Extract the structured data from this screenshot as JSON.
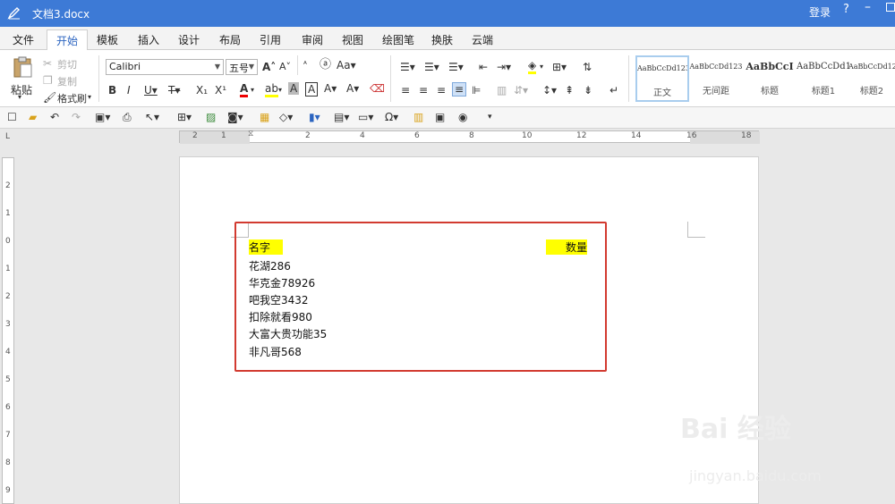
{
  "window": {
    "title": "文档3.docx",
    "login": "登录",
    "help": "?",
    "minimize": "–"
  },
  "tabs": [
    "文件",
    "开始",
    "模板",
    "插入",
    "设计",
    "布局",
    "引用",
    "审阅",
    "视图",
    "绘图笔",
    "换肤",
    "云端"
  ],
  "active_tab": "开始",
  "clipboard": {
    "paste": "粘贴",
    "cut": "剪切",
    "copy": "复制",
    "format_painter": "格式刷"
  },
  "font": {
    "family": "Calibri",
    "size": "五号"
  },
  "styles": [
    "正文",
    "无间距",
    "标题",
    "标题1",
    "标题2"
  ],
  "style_samples": [
    "AaBbCcDd123",
    "AaBbCcDd123",
    "AaBbCcI",
    "AaBbCcDd1",
    "AaBbCcDd123"
  ],
  "ruler": {
    "h_ticks": [
      "2",
      "1",
      "2",
      "4",
      "6",
      "8",
      "10",
      "12",
      "14",
      "16",
      "18"
    ],
    "v_ticks": [
      "2",
      "1",
      "0",
      "1",
      "2",
      "3",
      "4",
      "5",
      "6",
      "7",
      "8",
      "9"
    ],
    "corner": "L"
  },
  "document": {
    "header_name": "名字",
    "header_qty": "数量",
    "rows": [
      "花湖286",
      "华克金78926",
      "吧我空3432",
      "扣除就看980",
      "大富大贵功能35",
      "非凡哥568"
    ]
  },
  "watermark": {
    "text": "Bai 经验",
    "url": "jingyan.baidu.com"
  },
  "colors": {
    "titlebar": "#3d7ad6",
    "highlight": "#ffff00",
    "annotation_box": "#d23a30",
    "active_tab_text": "#2b64c0"
  }
}
